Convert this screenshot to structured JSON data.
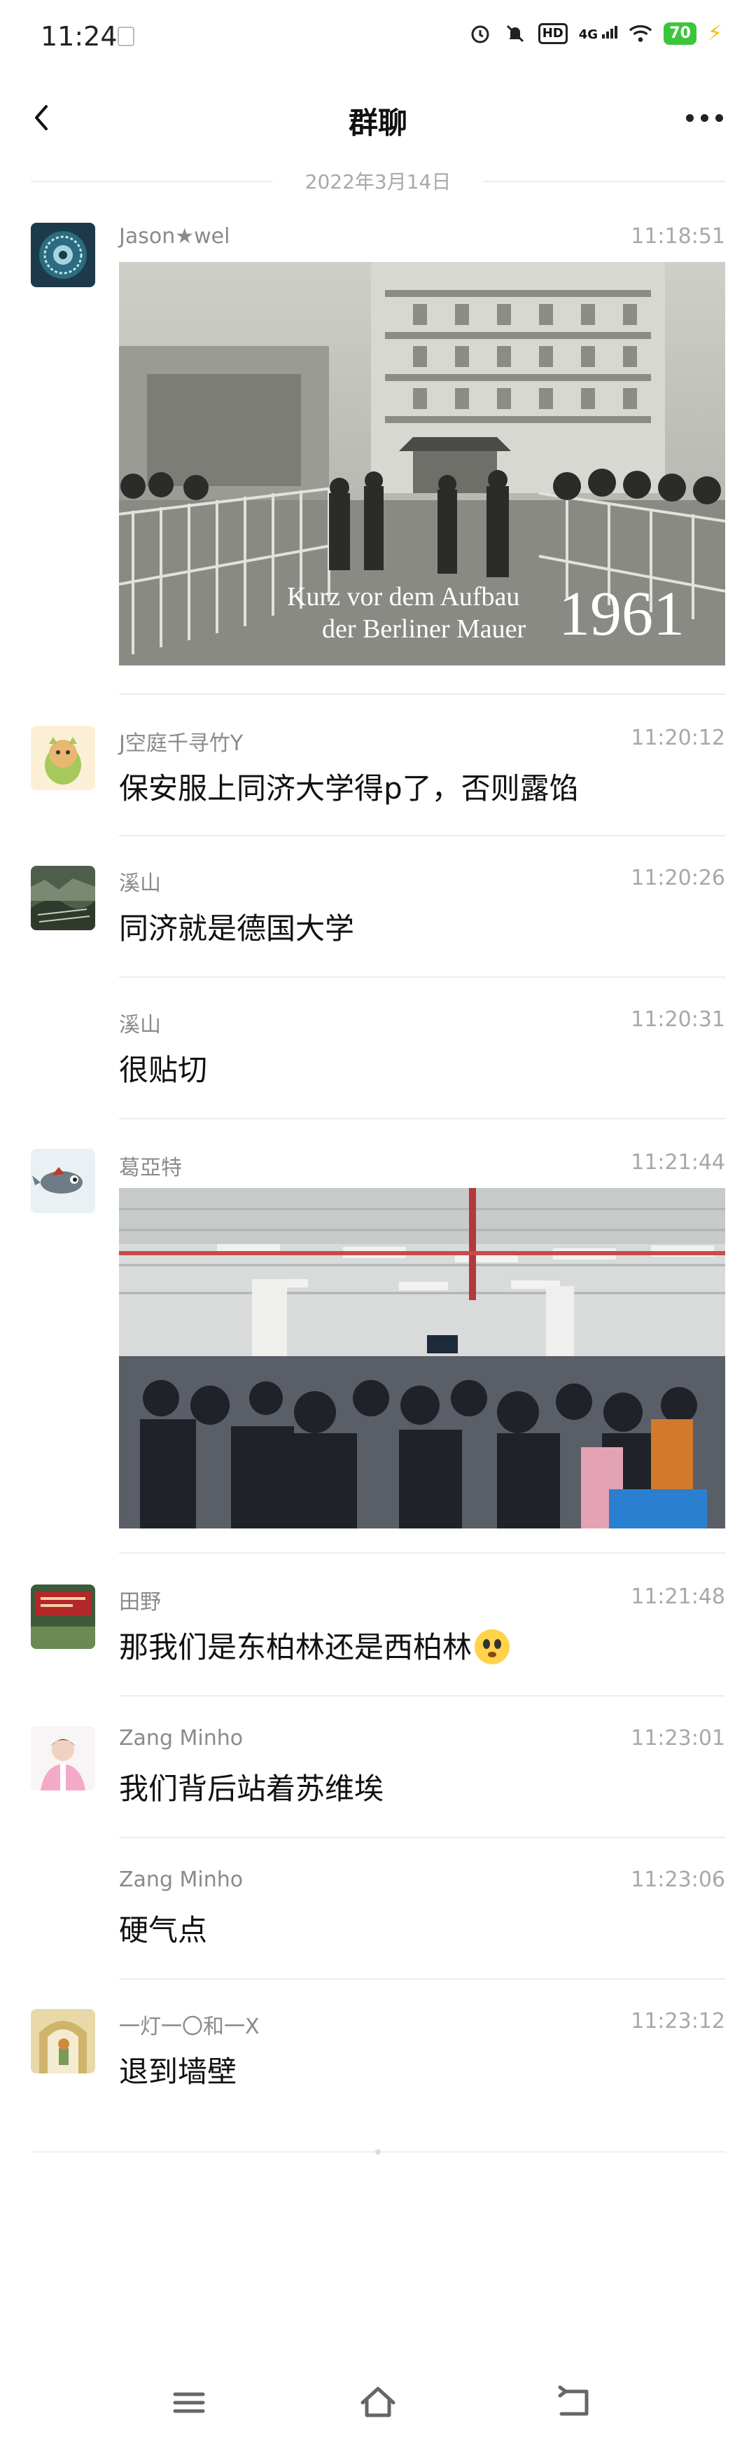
{
  "status_bar": {
    "time": "11:24",
    "network": "4G",
    "hd_label": "HD",
    "battery": "70"
  },
  "header": {
    "title": "群聊"
  },
  "date_divider": "2022年3月14日",
  "messages": [
    {
      "sender": "Jason★wel",
      "time": "11:18:51",
      "type": "image",
      "image_caption_line1": "Kurz vor dem Aufbau",
      "image_caption_line2": "der Berliner Mauer",
      "image_year": "1961"
    },
    {
      "sender": "J空庭千寻竹Y",
      "time": "11:20:12",
      "type": "text",
      "text": "保安服上同济大学得p了，否则露馅"
    },
    {
      "sender": "溪山",
      "time": "11:20:26",
      "type": "text",
      "text": "同济就是德国大学"
    },
    {
      "sender": "溪山",
      "time": "11:20:31",
      "type": "text",
      "text": "很贴切"
    },
    {
      "sender": "葛亞特",
      "time": "11:21:44",
      "type": "image"
    },
    {
      "sender": "田野",
      "time": "11:21:48",
      "type": "text",
      "text": "那我们是东柏林还是西柏林"
    },
    {
      "sender": "Zang  Minho",
      "time": "11:23:01",
      "type": "text",
      "text": "我们背后站着苏维埃"
    },
    {
      "sender": "Zang  Minho",
      "time": "11:23:06",
      "type": "text",
      "text": "硬气点"
    },
    {
      "sender": "一灯一〇和一X",
      "time": "11:23:12",
      "type": "text",
      "text": "退到墙壁"
    }
  ],
  "icons": {
    "back": "chevron-left-icon",
    "more": "more-horizontal-icon",
    "nav_menu": "menu-icon",
    "nav_home": "home-icon",
    "nav_back": "return-icon"
  }
}
